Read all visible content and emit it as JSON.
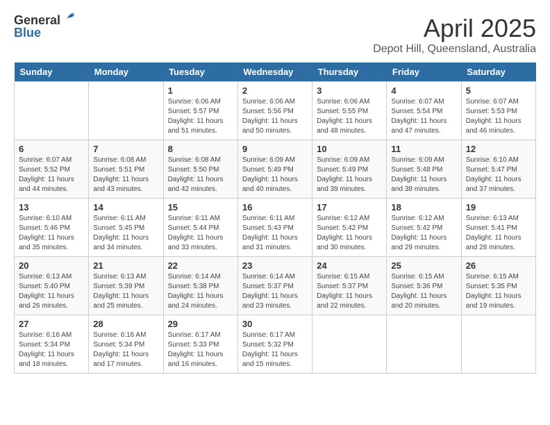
{
  "header": {
    "logo_general": "General",
    "logo_blue": "Blue",
    "month_title": "April 2025",
    "location": "Depot Hill, Queensland, Australia"
  },
  "days_of_week": [
    "Sunday",
    "Monday",
    "Tuesday",
    "Wednesday",
    "Thursday",
    "Friday",
    "Saturday"
  ],
  "weeks": [
    [
      {
        "day": "",
        "info": ""
      },
      {
        "day": "",
        "info": ""
      },
      {
        "day": "1",
        "info": "Sunrise: 6:06 AM\nSunset: 5:57 PM\nDaylight: 11 hours and 51 minutes."
      },
      {
        "day": "2",
        "info": "Sunrise: 6:06 AM\nSunset: 5:56 PM\nDaylight: 11 hours and 50 minutes."
      },
      {
        "day": "3",
        "info": "Sunrise: 6:06 AM\nSunset: 5:55 PM\nDaylight: 11 hours and 48 minutes."
      },
      {
        "day": "4",
        "info": "Sunrise: 6:07 AM\nSunset: 5:54 PM\nDaylight: 11 hours and 47 minutes."
      },
      {
        "day": "5",
        "info": "Sunrise: 6:07 AM\nSunset: 5:53 PM\nDaylight: 11 hours and 46 minutes."
      }
    ],
    [
      {
        "day": "6",
        "info": "Sunrise: 6:07 AM\nSunset: 5:52 PM\nDaylight: 11 hours and 44 minutes."
      },
      {
        "day": "7",
        "info": "Sunrise: 6:08 AM\nSunset: 5:51 PM\nDaylight: 11 hours and 43 minutes."
      },
      {
        "day": "8",
        "info": "Sunrise: 6:08 AM\nSunset: 5:50 PM\nDaylight: 11 hours and 42 minutes."
      },
      {
        "day": "9",
        "info": "Sunrise: 6:09 AM\nSunset: 5:49 PM\nDaylight: 11 hours and 40 minutes."
      },
      {
        "day": "10",
        "info": "Sunrise: 6:09 AM\nSunset: 5:49 PM\nDaylight: 11 hours and 39 minutes."
      },
      {
        "day": "11",
        "info": "Sunrise: 6:09 AM\nSunset: 5:48 PM\nDaylight: 11 hours and 38 minutes."
      },
      {
        "day": "12",
        "info": "Sunrise: 6:10 AM\nSunset: 5:47 PM\nDaylight: 11 hours and 37 minutes."
      }
    ],
    [
      {
        "day": "13",
        "info": "Sunrise: 6:10 AM\nSunset: 5:46 PM\nDaylight: 11 hours and 35 minutes."
      },
      {
        "day": "14",
        "info": "Sunrise: 6:11 AM\nSunset: 5:45 PM\nDaylight: 11 hours and 34 minutes."
      },
      {
        "day": "15",
        "info": "Sunrise: 6:11 AM\nSunset: 5:44 PM\nDaylight: 11 hours and 33 minutes."
      },
      {
        "day": "16",
        "info": "Sunrise: 6:11 AM\nSunset: 5:43 PM\nDaylight: 11 hours and 31 minutes."
      },
      {
        "day": "17",
        "info": "Sunrise: 6:12 AM\nSunset: 5:42 PM\nDaylight: 11 hours and 30 minutes."
      },
      {
        "day": "18",
        "info": "Sunrise: 6:12 AM\nSunset: 5:42 PM\nDaylight: 11 hours and 29 minutes."
      },
      {
        "day": "19",
        "info": "Sunrise: 6:13 AM\nSunset: 5:41 PM\nDaylight: 11 hours and 28 minutes."
      }
    ],
    [
      {
        "day": "20",
        "info": "Sunrise: 6:13 AM\nSunset: 5:40 PM\nDaylight: 11 hours and 26 minutes."
      },
      {
        "day": "21",
        "info": "Sunrise: 6:13 AM\nSunset: 5:39 PM\nDaylight: 11 hours and 25 minutes."
      },
      {
        "day": "22",
        "info": "Sunrise: 6:14 AM\nSunset: 5:38 PM\nDaylight: 11 hours and 24 minutes."
      },
      {
        "day": "23",
        "info": "Sunrise: 6:14 AM\nSunset: 5:37 PM\nDaylight: 11 hours and 23 minutes."
      },
      {
        "day": "24",
        "info": "Sunrise: 6:15 AM\nSunset: 5:37 PM\nDaylight: 11 hours and 22 minutes."
      },
      {
        "day": "25",
        "info": "Sunrise: 6:15 AM\nSunset: 5:36 PM\nDaylight: 11 hours and 20 minutes."
      },
      {
        "day": "26",
        "info": "Sunrise: 6:15 AM\nSunset: 5:35 PM\nDaylight: 11 hours and 19 minutes."
      }
    ],
    [
      {
        "day": "27",
        "info": "Sunrise: 6:16 AM\nSunset: 5:34 PM\nDaylight: 11 hours and 18 minutes."
      },
      {
        "day": "28",
        "info": "Sunrise: 6:16 AM\nSunset: 5:34 PM\nDaylight: 11 hours and 17 minutes."
      },
      {
        "day": "29",
        "info": "Sunrise: 6:17 AM\nSunset: 5:33 PM\nDaylight: 11 hours and 16 minutes."
      },
      {
        "day": "30",
        "info": "Sunrise: 6:17 AM\nSunset: 5:32 PM\nDaylight: 11 hours and 15 minutes."
      },
      {
        "day": "",
        "info": ""
      },
      {
        "day": "",
        "info": ""
      },
      {
        "day": "",
        "info": ""
      }
    ]
  ]
}
